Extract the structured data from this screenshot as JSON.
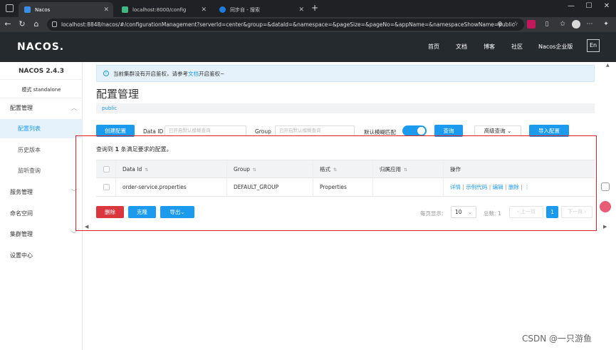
{
  "browser": {
    "tabs": [
      {
        "title": "Nacos"
      },
      {
        "title": "localhost:8000/config"
      },
      {
        "title": "同步自 - 搜索"
      }
    ],
    "url": "localhost:8848/nacos/#/configurationManagement?serverId=center&group=&dataId=&namespace=&pageSize=&pageNo=&appName=&namespaceShowName=public"
  },
  "header": {
    "logo": "NACOS.",
    "nav": [
      "首页",
      "文档",
      "博客",
      "社区",
      "Nacos企业版"
    ],
    "lang": "En"
  },
  "sidebar": {
    "version": "NACOS 2.4.3",
    "mode": "模式 standalone",
    "items": [
      {
        "label": "配置管理"
      },
      {
        "label": "配置列表"
      },
      {
        "label": "历史版本"
      },
      {
        "label": "监听查询"
      },
      {
        "label": "服务管理"
      },
      {
        "label": "命名空间"
      },
      {
        "label": "集群管理"
      },
      {
        "label": "设置中心"
      }
    ]
  },
  "main": {
    "notice_prefix": "当前集群没有开启鉴权，请参考",
    "notice_link": "文档",
    "notice_suffix": "开启鉴权~",
    "title": "配置管理",
    "namespace": "public",
    "filters": {
      "create_btn": "创建配置",
      "dataid_label": "Data ID",
      "dataid_placeholder": "已开启默认模糊查询",
      "group_label": "Group",
      "group_placeholder": "已开启默认模糊查询",
      "fuzzy_label": "默认模糊匹配",
      "query_btn": "查询",
      "advanced_btn": "高级查询",
      "import_btn": "导入配置"
    },
    "result_prefix": "查询到",
    "result_count": "1",
    "result_suffix": "条满足要求的配置。",
    "table": {
      "headers": [
        "Data Id",
        "Group",
        "格式",
        "归属应用",
        "操作"
      ],
      "rows": [
        {
          "data_id": "order-service.properties",
          "group": "DEFAULT_GROUP",
          "format": "Properties",
          "app": "",
          "actions": [
            "详情",
            "示例代码",
            "编辑",
            "删除"
          ]
        }
      ]
    },
    "bulk": {
      "delete_btn": "删除",
      "clone_btn": "克隆",
      "export_btn": "导出"
    },
    "pager": {
      "page_size_label": "每页显示:",
      "page_size": "10",
      "total_label": "总数: 1",
      "prev": "上一页",
      "current": "1",
      "next": "下一页"
    }
  },
  "watermark": "CSDN @一只游鱼",
  "colors": {
    "primary": "#1b9aee",
    "danger": "#d9363e",
    "highlight_box": "#e02020",
    "header_bg": "#252a2f"
  }
}
